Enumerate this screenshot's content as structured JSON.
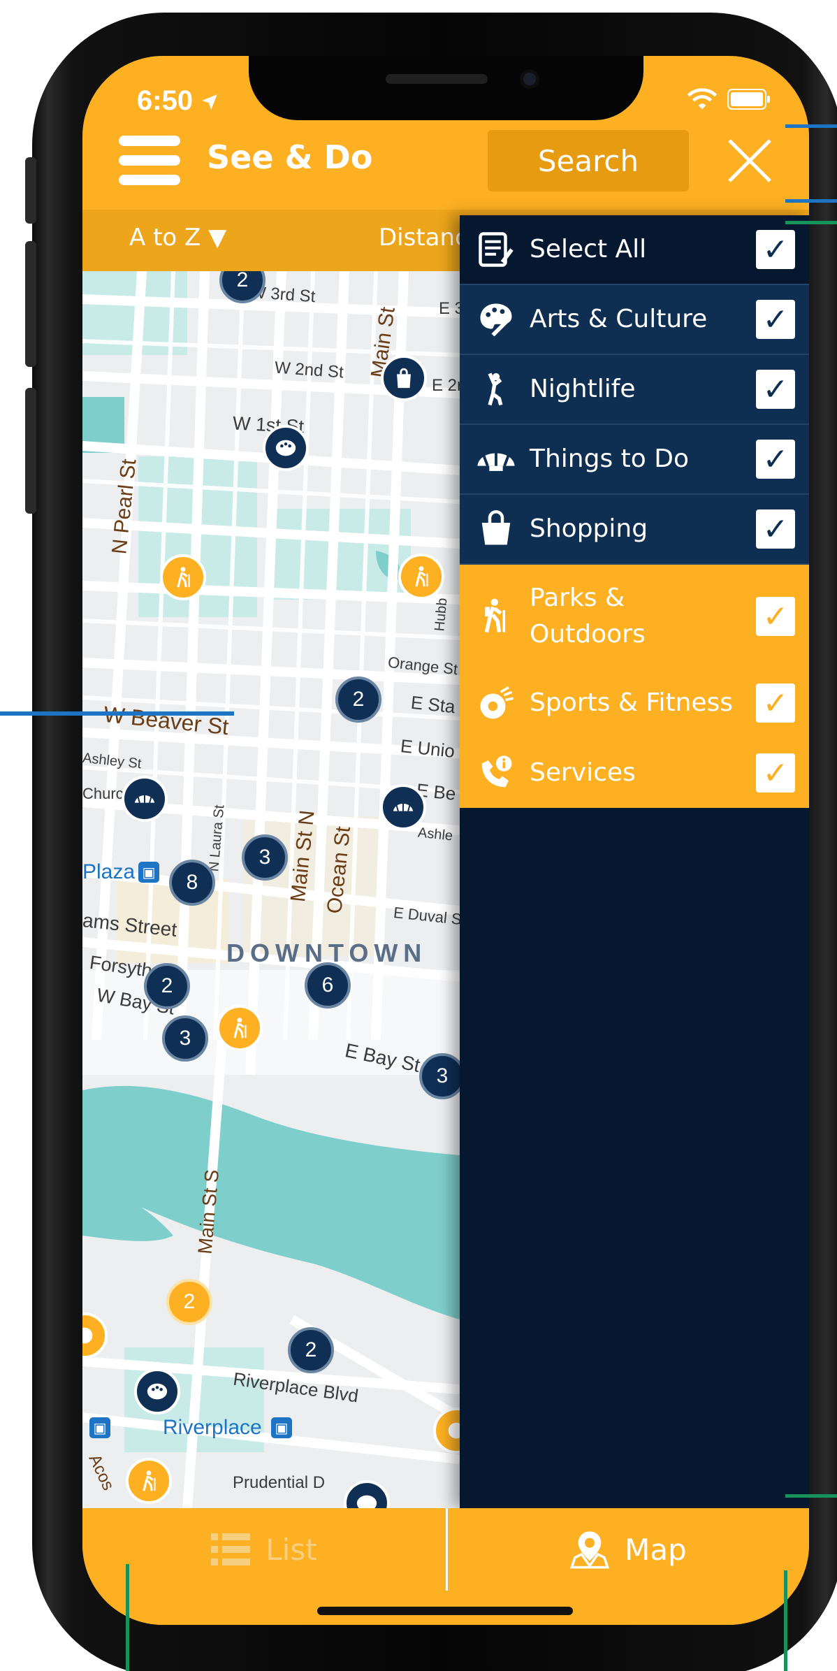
{
  "status_bar": {
    "time": "6:50"
  },
  "header": {
    "title": "See & Do",
    "search_label": "Search"
  },
  "sort_bar": {
    "a_to_z": "A to Z ▼",
    "distance": "Distanc"
  },
  "map": {
    "streets": [
      "W 3rd St",
      "E 3",
      "W 2nd St",
      "E 2r",
      "Main St",
      "W 1st St",
      "N Pearl St",
      "Hubb",
      "Orange St",
      "E Sta",
      "W Beaver St",
      "E Unio",
      "Ashley St",
      "E Be",
      "Ashle",
      "Church",
      "N Laura St",
      "Main St N",
      "Ocean St",
      "Plaza",
      "ams Street",
      "E Duval S",
      "DOWNTOWN",
      "Forsyth",
      "W Bay St",
      "E Bay St",
      "Main St S",
      "Riverplace Blvd",
      "Riverplace",
      "Prudential D",
      "Acos"
    ],
    "cluster_counts": [
      "2",
      "2",
      "3",
      "8",
      "2",
      "6",
      "3",
      "3",
      "2",
      "2"
    ]
  },
  "filters": [
    {
      "label": "Select All",
      "icon": "list-icon",
      "checked": true
    },
    {
      "label": "Arts & Culture",
      "icon": "palette-icon",
      "checked": true
    },
    {
      "label": "Nightlife",
      "icon": "dancer-icon",
      "checked": true
    },
    {
      "label": "Things to Do",
      "icon": "shell-icon",
      "checked": true
    },
    {
      "label": "Shopping",
      "icon": "shopping-bag-icon",
      "checked": true
    },
    {
      "label_line1": "Parks &",
      "label_line2": "Outdoors",
      "icon": "hiker-icon",
      "checked": true
    },
    {
      "label": "Sports & Fitness",
      "icon": "ball-icon",
      "checked": true
    },
    {
      "label": "Services",
      "icon": "phone-info-icon",
      "checked": true
    }
  ],
  "tabs": {
    "list": "List",
    "map": "Map"
  },
  "colors": {
    "gold": "#fcb022",
    "navy": "#0e2e52",
    "dark_navy": "#06182f",
    "map_water": "#7ecfcc"
  }
}
